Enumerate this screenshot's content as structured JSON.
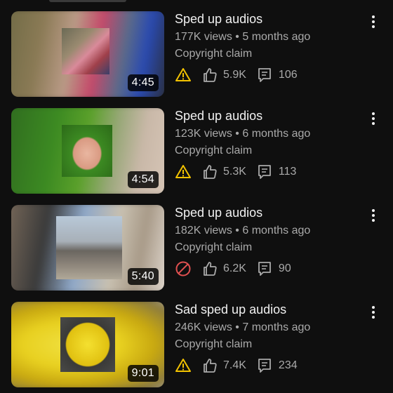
{
  "videos": [
    {
      "title": "Sped up audios",
      "views": "177K views",
      "separator": "•",
      "age": "5 months ago",
      "restriction": "Copyright claim",
      "status_icon": "warning-icon",
      "likes": "5.9K",
      "comments": "106",
      "duration": "4:45"
    },
    {
      "title": "Sped up audios",
      "views": "123K views",
      "separator": "•",
      "age": "6 months ago",
      "restriction": "Copyright claim",
      "status_icon": "warning-icon",
      "likes": "5.3K",
      "comments": "113",
      "duration": "4:54"
    },
    {
      "title": "Sped up audios",
      "views": "182K views",
      "separator": "•",
      "age": "6 months ago",
      "restriction": "Copyright claim",
      "status_icon": "blocked-icon",
      "likes": "6.2K",
      "comments": "90",
      "duration": "5:40"
    },
    {
      "title": "Sad sped up audios",
      "views": "246K views",
      "separator": "•",
      "age": "7 months ago",
      "restriction": "Copyright claim",
      "status_icon": "warning-icon",
      "likes": "7.4K",
      "comments": "234",
      "duration": "9:01"
    }
  ],
  "colors": {
    "background": "#0f0f0f",
    "title_text": "#f1f1f1",
    "secondary_text": "#aaaaaa",
    "warning": "#f2c200",
    "blocked": "#e05050"
  }
}
